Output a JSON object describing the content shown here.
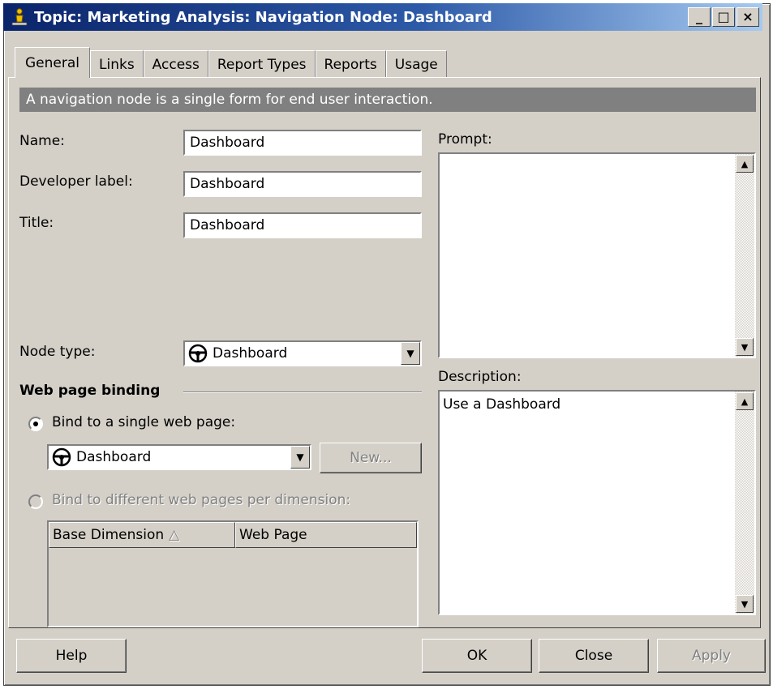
{
  "window": {
    "title": "Topic: Marketing Analysis: Navigation Node: Dashboard",
    "controls": {
      "minimize": "_",
      "maximize": "□",
      "close": "×"
    }
  },
  "tabs": [
    {
      "label": "General",
      "active": true
    },
    {
      "label": "Links",
      "active": false
    },
    {
      "label": "Access",
      "active": false
    },
    {
      "label": "Report Types",
      "active": false
    },
    {
      "label": "Reports",
      "active": false
    },
    {
      "label": "Usage",
      "active": false
    }
  ],
  "info_text": "A navigation node is a single form for end user interaction.",
  "form": {
    "name_label": "Name:",
    "name_value": "Dashboard",
    "developer_label_label": "Developer label:",
    "developer_label_value": "Dashboard",
    "title_label": "Title:",
    "title_value": "Dashboard",
    "node_type_label": "Node type:",
    "node_type_value": "Dashboard",
    "prompt_label": "Prompt:",
    "prompt_value": "",
    "description_label": "Description:",
    "description_value": "Use a Dashboard"
  },
  "web_page_binding": {
    "heading": "Web page binding",
    "single_option": "Bind to a single web page:",
    "single_selected": true,
    "page_value": "Dashboard",
    "new_button": "New...",
    "multi_option": "Bind to different web pages per dimension:",
    "columns": [
      "Base Dimension",
      "Web Page"
    ],
    "sort_indicator": "△"
  },
  "buttons": {
    "help": "Help",
    "ok": "OK",
    "close": "Close",
    "apply": "Apply"
  },
  "colors": {
    "title_bar_start": "#0a246a",
    "title_bar_end": "#a6caf0",
    "dialog_face": "#d4d0c8",
    "info_bar": "#808080"
  },
  "icons": {
    "app": "yellow-person-icon",
    "node_type": "steering-wheel-icon"
  }
}
